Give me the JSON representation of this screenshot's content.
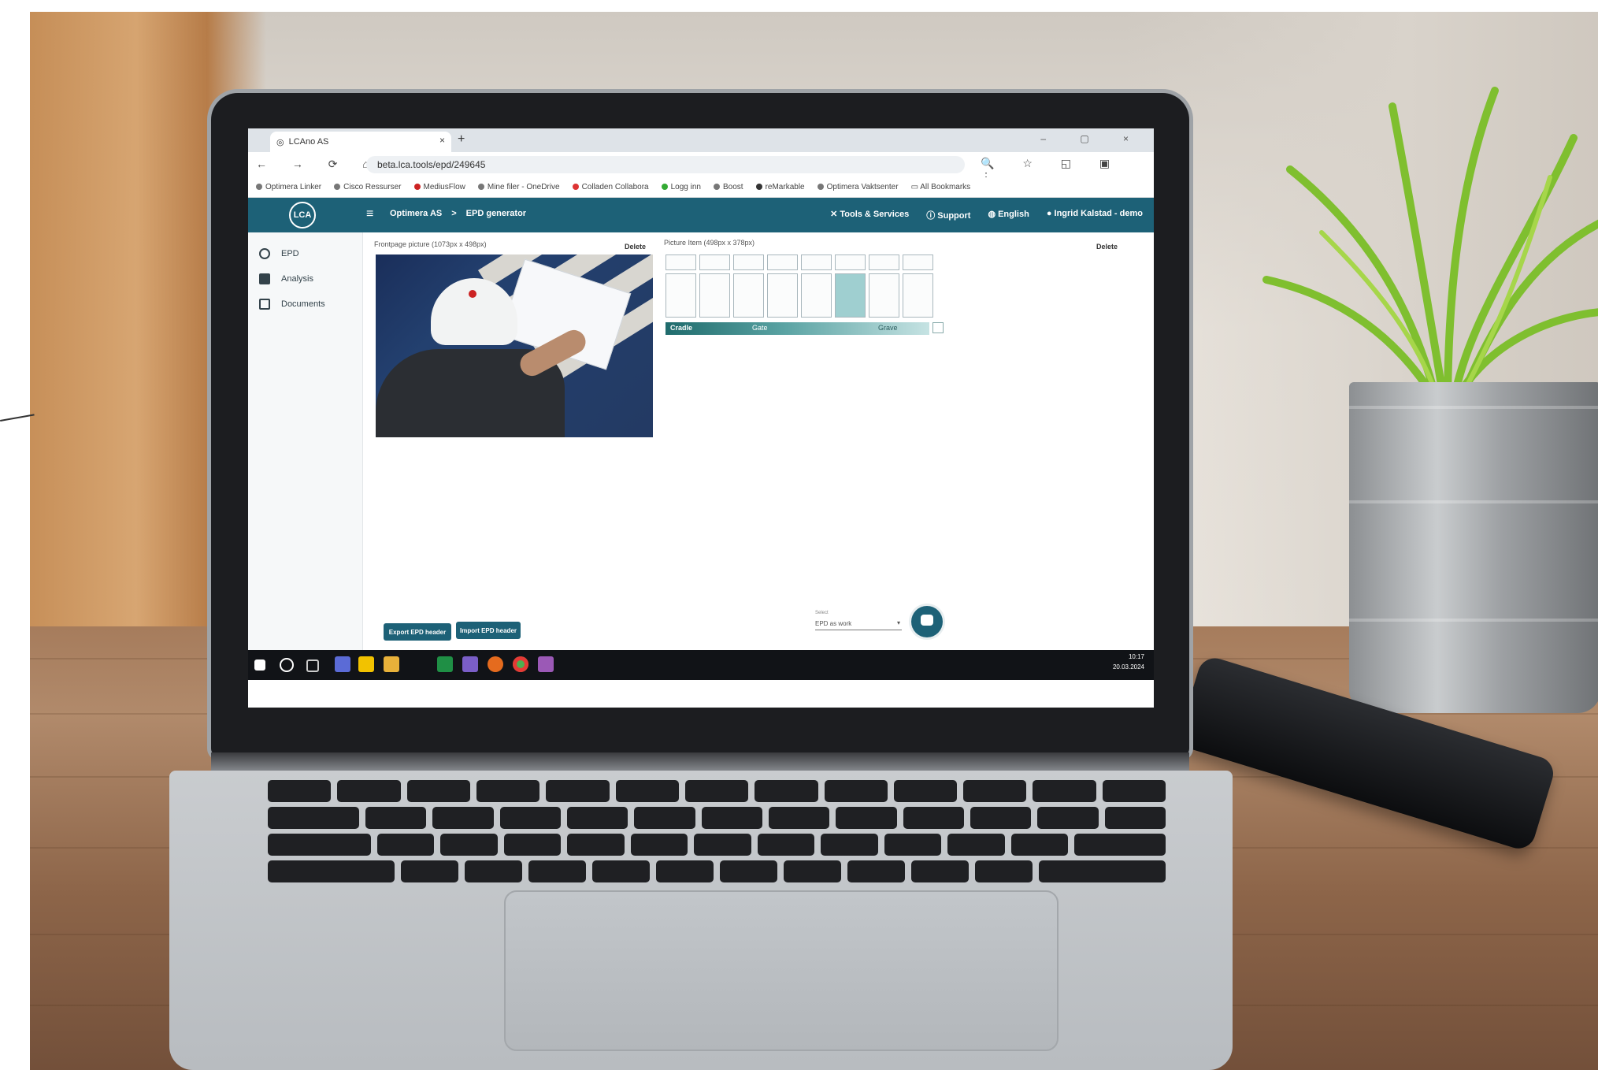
{
  "browser": {
    "tab_title": "LCAno AS",
    "url": "beta.lca.tools/epd/249645",
    "bookmarks": [
      "Optimera Linker",
      "Cisco Ressurser",
      "MediusFlow",
      "Mine filer - OneDrive",
      "Colladen Collabora",
      "Logg inn",
      "Boost",
      "reMarkable",
      "Optimera Vaktsenter",
      "All Bookmarks"
    ]
  },
  "app": {
    "logo": "LCA",
    "breadcrumb": {
      "org": "Optimera AS",
      "separator": ">",
      "page": "EPD generator"
    },
    "header_links": {
      "tools": "Tools & Services",
      "support": "Support",
      "language": "English",
      "user": "Ingrid Kalstad - demo"
    },
    "sidebar": [
      {
        "label": "EPD",
        "icon": "epd-icon"
      },
      {
        "label": "Analysis",
        "icon": "analysis-icon"
      },
      {
        "label": "Documents",
        "icon": "documents-icon"
      }
    ],
    "front_picture": {
      "label": "Frontpage picture (1073px x 498px)",
      "delete": "Delete"
    },
    "back_picture": {
      "label": "Picture Item (498px x 378px)",
      "delete": "Delete"
    },
    "lifecycle": {
      "cradle": "Cradle",
      "gate": "Gate",
      "grave": "Grave"
    },
    "buttons": {
      "export": "Export EPD header",
      "import": "Import EPD header"
    },
    "select": {
      "label": "Select",
      "value": "EPD as work"
    }
  },
  "taskbar": {
    "time": "10:17",
    "date": "20.03.2024"
  },
  "colors": {
    "accent": "#1d6177",
    "lifecycle_start": "#1f6b6c",
    "lifecycle_end": "#c6e3e3"
  }
}
